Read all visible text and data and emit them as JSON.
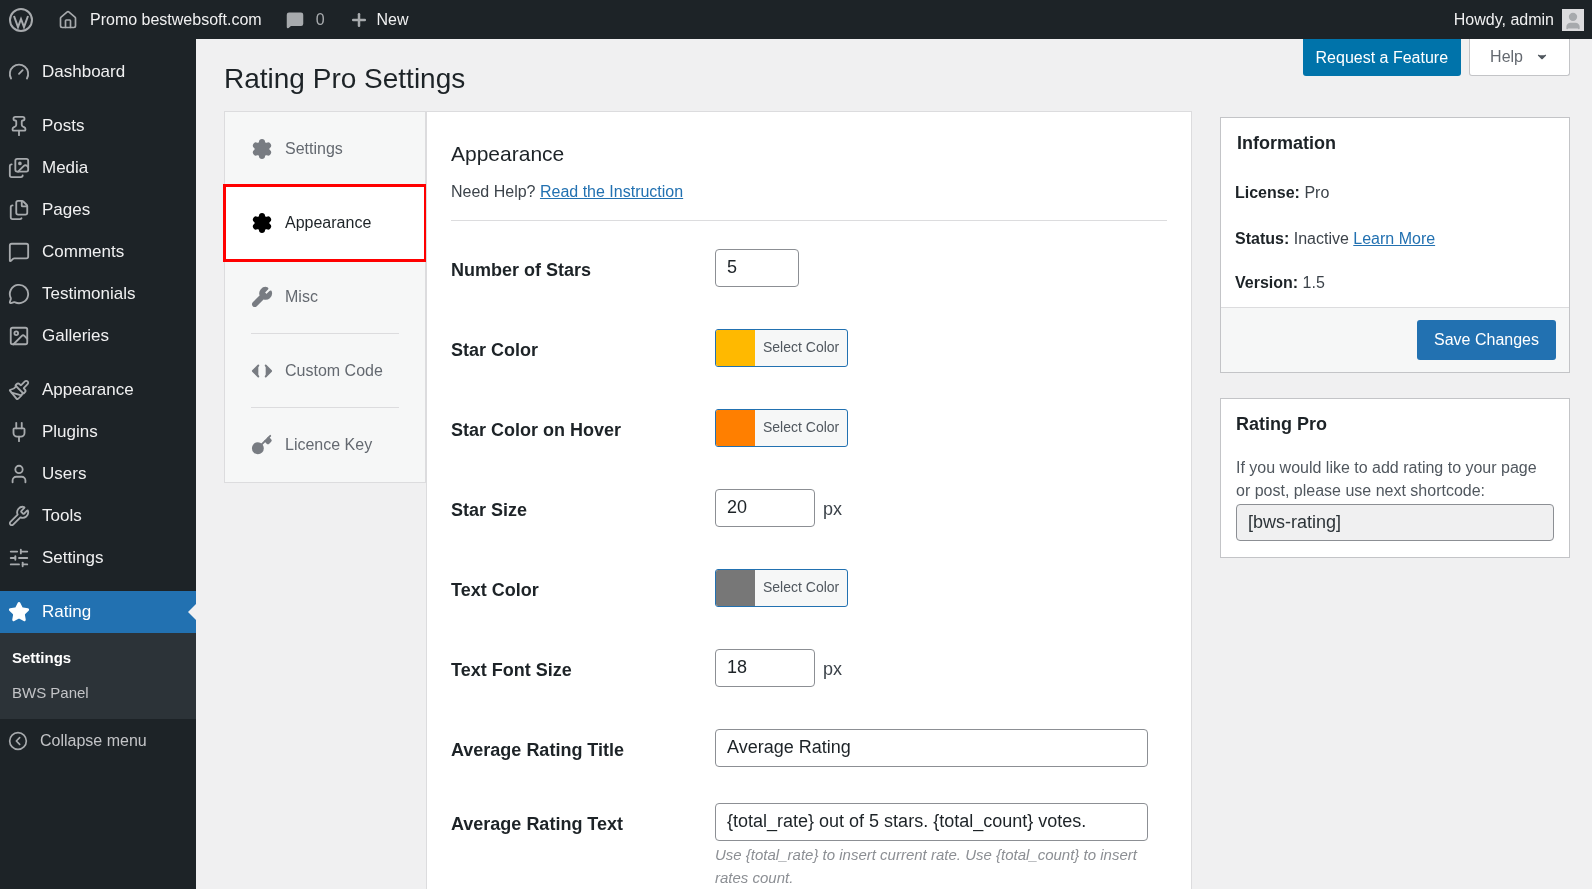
{
  "admin_bar": {
    "site": "Promo bestwebsoft.com",
    "comments": "0",
    "new": "New",
    "greeting": "Howdy, admin"
  },
  "sidebar": {
    "groups": [
      [
        {
          "label": "Dashboard",
          "selected": false
        }
      ],
      [
        {
          "label": "Posts",
          "selected": false
        },
        {
          "label": "Media",
          "selected": false
        },
        {
          "label": "Pages",
          "selected": false
        },
        {
          "label": "Comments",
          "selected": false
        },
        {
          "label": "Testimonials",
          "selected": false
        },
        {
          "label": "Galleries",
          "selected": false
        }
      ],
      [
        {
          "label": "Appearance",
          "selected": false
        },
        {
          "label": "Plugins",
          "selected": false
        },
        {
          "label": "Users",
          "selected": false
        },
        {
          "label": "Tools",
          "selected": false
        },
        {
          "label": "Settings",
          "selected": false
        }
      ],
      [
        {
          "label": "Rating",
          "selected": true
        }
      ]
    ],
    "submenu": [
      {
        "label": "Settings",
        "selected": true
      },
      {
        "label": "BWS Panel",
        "selected": false
      }
    ],
    "collapse": "Collapse menu"
  },
  "page_title": "Rating Pro Settings",
  "header_buttons": {
    "request": "Request a Feature",
    "help": "Help"
  },
  "tabs": [
    {
      "label": "Settings",
      "selected": false,
      "highlighted": false
    },
    {
      "label": "Appearance",
      "selected": true,
      "highlighted": true
    },
    {
      "label": "Misc",
      "selected": false,
      "highlighted": false
    },
    {
      "label": "Custom Code",
      "selected": false,
      "highlighted": false
    },
    {
      "label": "Licence Key",
      "selected": false,
      "highlighted": false
    }
  ],
  "section": {
    "title": "Appearance",
    "help_text": "Need Help?",
    "help_link": "Read the Instruction"
  },
  "fields": [
    {
      "kind": "number",
      "label": "Number of Stars",
      "value": "5"
    },
    {
      "kind": "color",
      "label": "Star Color",
      "color": "#ffb900",
      "button": "Select Color"
    },
    {
      "kind": "color",
      "label": "Star Color on Hover",
      "color": "#ff7f00",
      "button": "Select Color"
    },
    {
      "kind": "number",
      "label": "Star Size",
      "value": "20",
      "unit": "px"
    },
    {
      "kind": "color",
      "label": "Text Color",
      "color": "#777777",
      "button": "Select Color"
    },
    {
      "kind": "number",
      "label": "Text Font Size",
      "value": "18",
      "unit": "px"
    },
    {
      "kind": "text",
      "label": "Average Rating Title",
      "value": "Average Rating"
    },
    {
      "kind": "text",
      "label": "Average Rating Text",
      "value": "{total_rate} out of 5 stars. {total_count} votes.",
      "hint": "Use {total_rate} to insert current rate. Use {total_count} to insert rates count."
    }
  ],
  "info_box": {
    "title": "Information",
    "license_label": "License:",
    "license": "Pro",
    "status_label": "Status:",
    "status": "Inactive",
    "status_link": "Learn More",
    "version_label": "Version:",
    "version": "1.5",
    "save": "Save Changes"
  },
  "shortcode_box": {
    "title": "Rating Pro",
    "text": "If you would like to add rating to your page or post, please use next shortcode:",
    "shortcode": "[bws-rating]"
  }
}
